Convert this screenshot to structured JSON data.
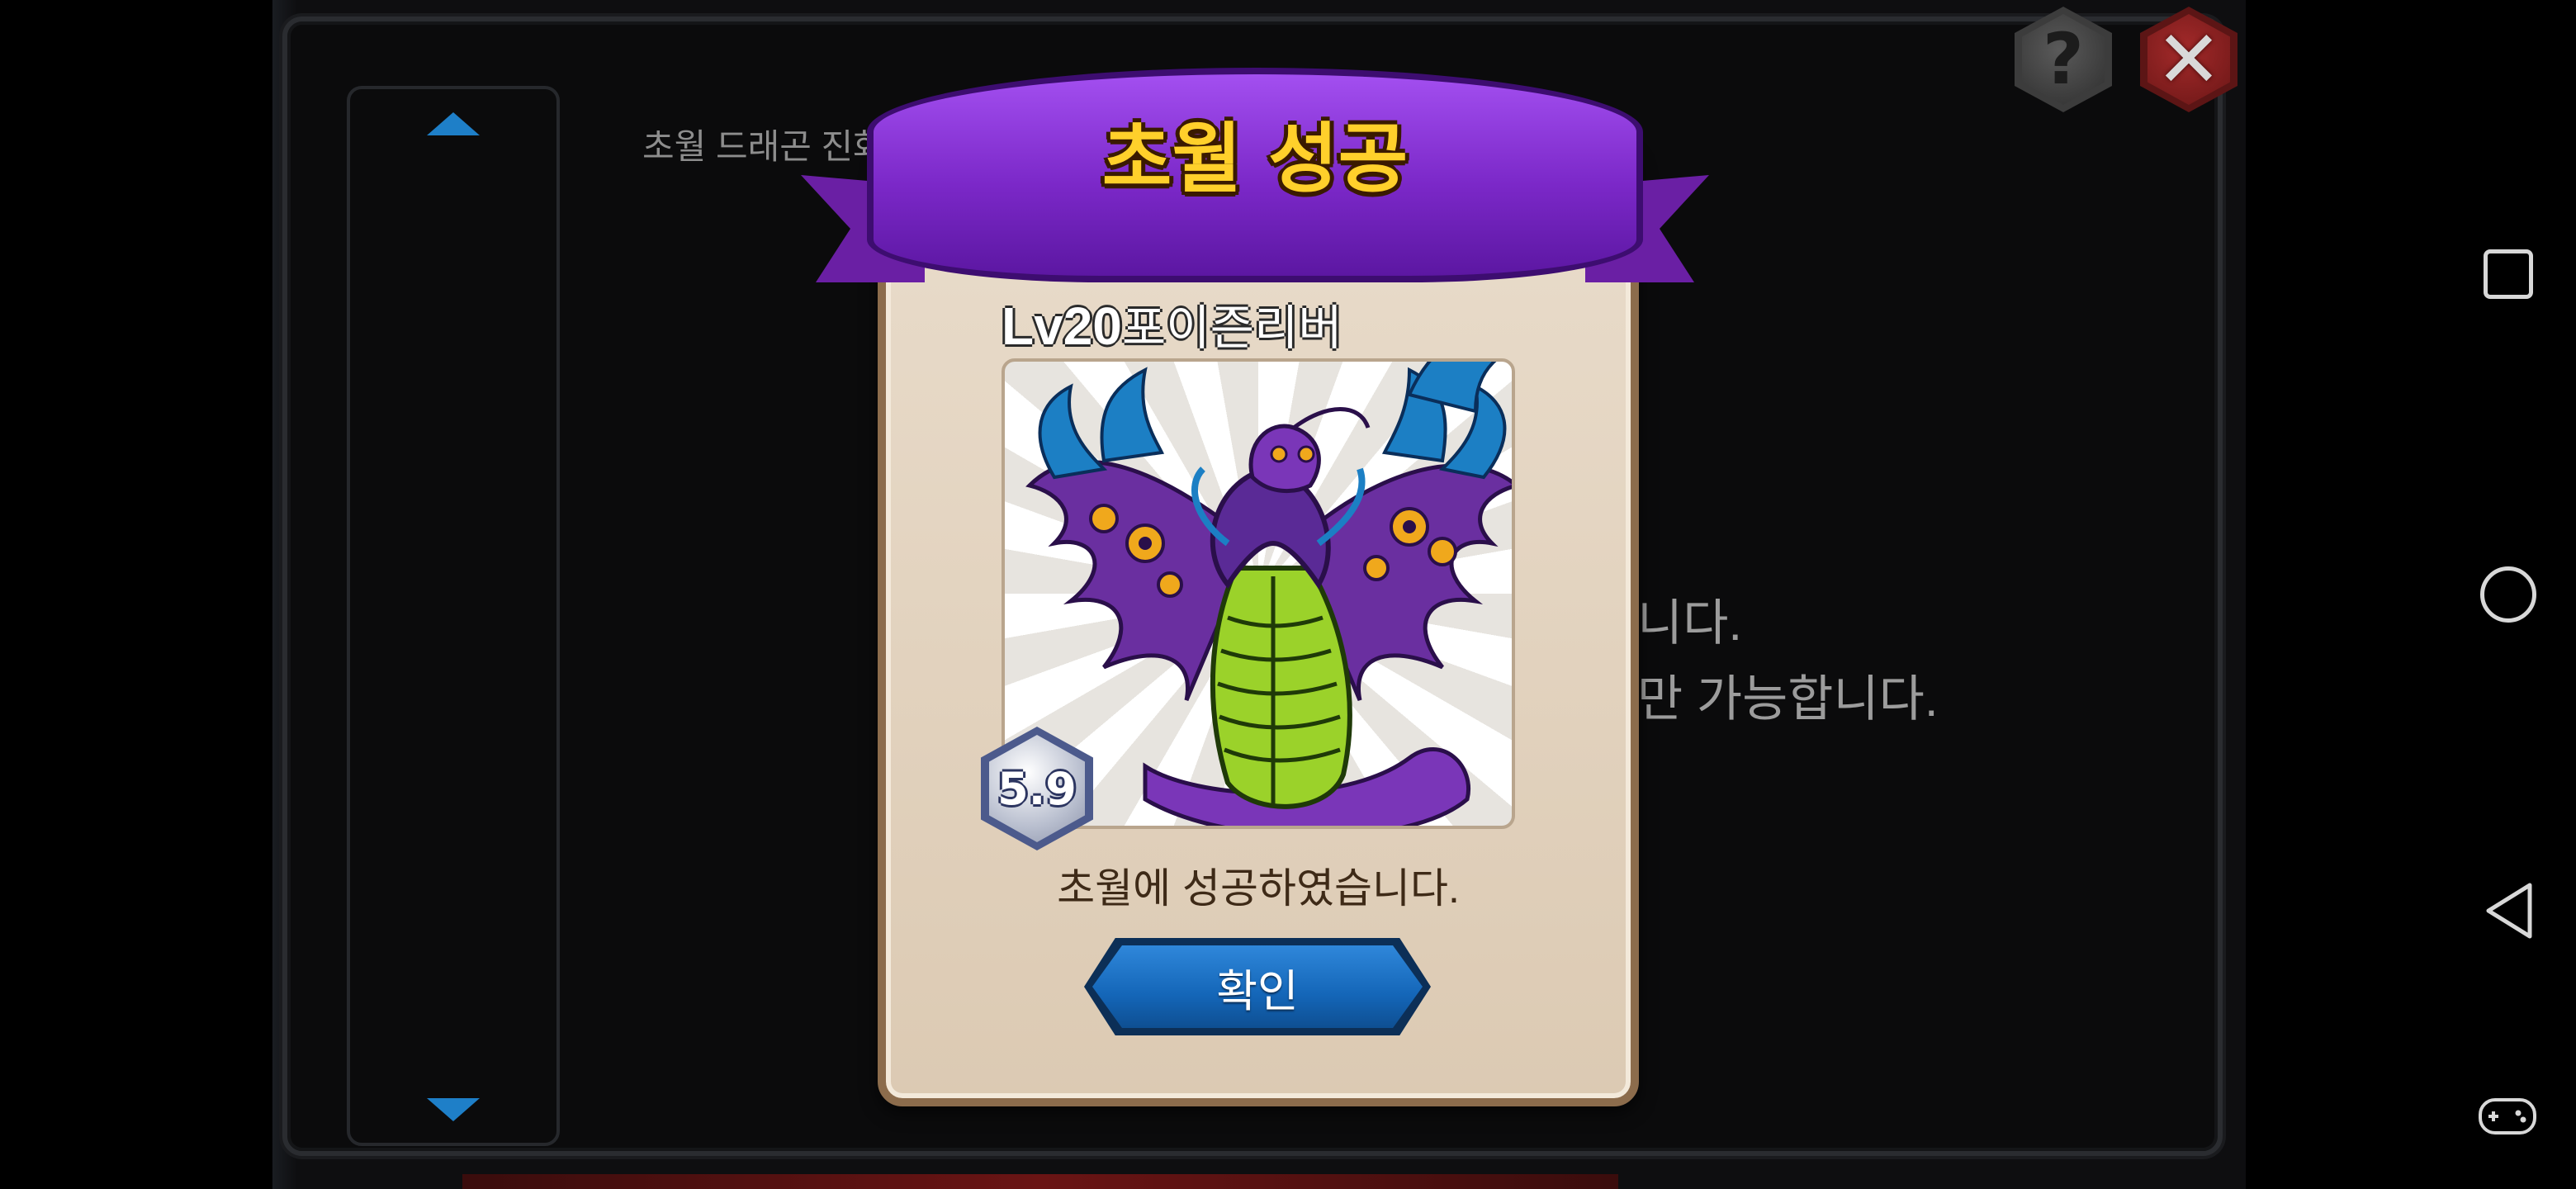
{
  "background": {
    "title_partial": "초월 드래곤 진화",
    "line1_partial": "니다.",
    "line2_partial": "만 가능합니다."
  },
  "header_buttons": {
    "help_glyph": "?",
    "close_glyph": "✕"
  },
  "dialog": {
    "ribbon_title": "초월 성공",
    "level": "Lv20",
    "monster_name": "포이즌리버",
    "grade": "5.9",
    "message": "초월에 성공하였습니다.",
    "confirm_label": "확인"
  },
  "colors": {
    "ribbon": "#7b28c8",
    "title_text": "#ffd02b",
    "confirm_button": "#1466b8",
    "dialog_bg": "#e9dccb"
  },
  "nav_icons": [
    "recents-square-icon",
    "home-circle-icon",
    "back-triangle-icon",
    "game-controller-icon"
  ]
}
